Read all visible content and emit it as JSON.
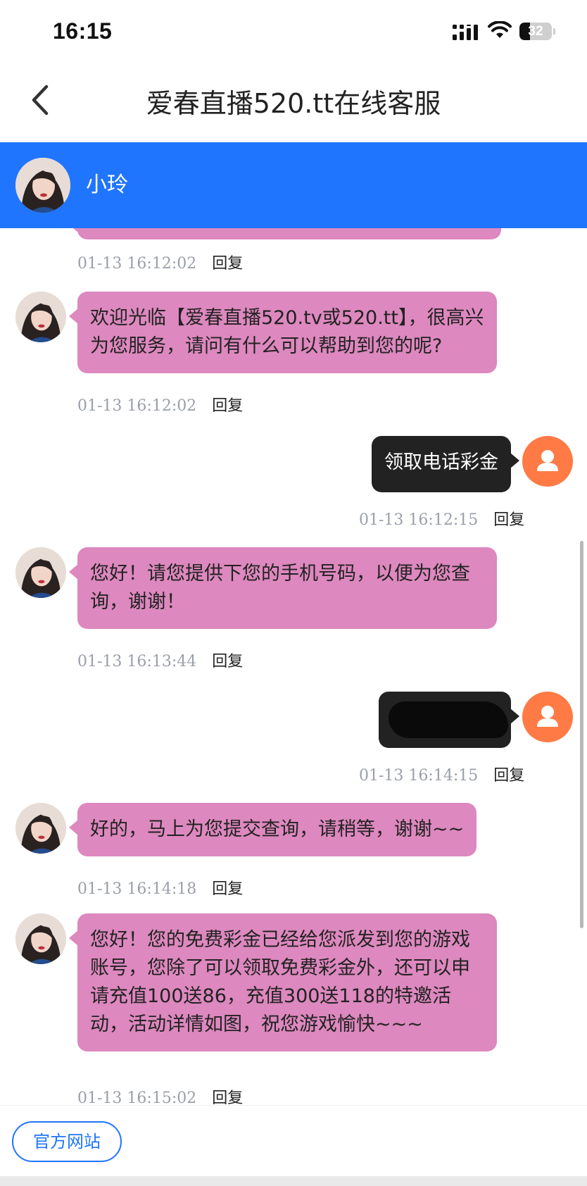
{
  "status_bar": {
    "time": "16:15",
    "battery": "32",
    "battery_level": 0.32
  },
  "nav": {
    "title": "爱春直播520.tt在线客服"
  },
  "agent": {
    "name": "小玲"
  },
  "messages": [
    {
      "from": "agent",
      "text": "",
      "time": "01-13 16:12:02",
      "reply": "回复"
    },
    {
      "from": "agent",
      "text": "欢迎光临【爱春直播520.tv或520.tt】，很高兴为您服务，请问有什么可以帮助到您的呢?",
      "time": "01-13 16:12:02",
      "reply": "回复"
    },
    {
      "from": "user",
      "text": "领取电话彩金",
      "time": "01-13 16:12:15",
      "reply": "回复"
    },
    {
      "from": "agent",
      "text": "您好！请您提供下您的手机号码，以便为您查询，谢谢！",
      "time": "01-13 16:13:44",
      "reply": "回复"
    },
    {
      "from": "user",
      "text": "",
      "redacted": true,
      "time": "01-13 16:14:15",
      "reply": "回复"
    },
    {
      "from": "agent",
      "text": "好的，马上为您提交查询，请稍等，谢谢~~",
      "time": "01-13 16:14:18",
      "reply": "回复"
    },
    {
      "from": "agent",
      "text": "您好！您的免费彩金已经给您派发到您的游戏账号，您除了可以领取免费彩金外，还可以申请充值100送86，充值300送118的特邀活动，活动详情如图，祝您游戏愉快~~~",
      "time": "01-13 16:15:02",
      "reply": "回复"
    }
  ],
  "footer": {
    "official_site_label": "官方网站"
  },
  "colors": {
    "accent": "#1f75fe",
    "agent_bubble": "#dd88bf",
    "user_bubble": "#222222",
    "user_avatar": "#ff7a45"
  }
}
